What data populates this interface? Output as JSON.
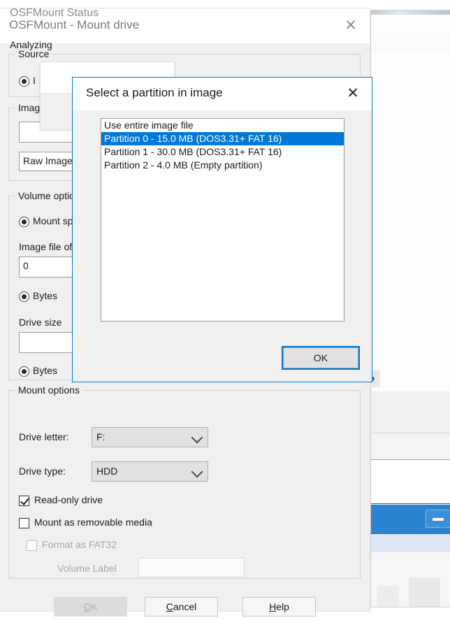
{
  "background_windows": {
    "right_window": {
      "maximize_icon": "maximize-icon",
      "close_icon": "close-icon"
    },
    "scroll_arrow": "›"
  },
  "main_window": {
    "title": "OSFMount - Mount drive",
    "close_icon": "✕",
    "source_group": {
      "legend": "Source",
      "radio_label": "I",
      "radio_checked": true
    },
    "image_group": {
      "legend": "Imag",
      "path_value": "",
      "format_value": "Raw Image"
    },
    "volume_group": {
      "legend": "Volume options",
      "mount_radio_label": "Mount spe",
      "mount_radio_checked": true,
      "offset_label": "Image file offs",
      "offset_value": "0",
      "offset_unit_label": "Bytes",
      "offset_unit_checked": true,
      "drive_size_label": "Drive size",
      "drive_size_value": "",
      "size_unit_label": "Bytes",
      "size_unit_checked": true
    },
    "mount_group": {
      "legend": "Mount options",
      "drive_letter_label": "Drive letter:",
      "drive_letter_value": "F:",
      "drive_type_label": "Drive type:",
      "drive_type_value": "HDD",
      "read_only_label": "Read-only drive",
      "read_only_checked": true,
      "removable_label": "Mount as removable media",
      "removable_checked": false,
      "format_fat32_label": "Format as FAT32",
      "format_fat32_checked": false,
      "format_fat32_enabled": false,
      "volume_label_label": "Volume Label",
      "volume_label_value": "",
      "volume_label_enabled": false
    },
    "buttons": {
      "ok": "OK",
      "ok_enabled": false,
      "cancel": "Cancel",
      "help": "Help"
    }
  },
  "status_dialog": {
    "title": "OSFMount Status",
    "message": "Analyzing"
  },
  "partition_dialog": {
    "title": "Select a partition in image",
    "close_icon": "✕",
    "items": [
      {
        "label": "Use entire image file",
        "selected": false
      },
      {
        "label": "Partition 0 - 15.0 MB (DOS3.31+ FAT 16)",
        "selected": true
      },
      {
        "label": "Partition 1 - 30.0 MB (DOS3.31+ FAT 16)",
        "selected": false
      },
      {
        "label": "Partition 2 - 4.0 MB (Empty partition)",
        "selected": false
      }
    ],
    "ok_button": "OK"
  },
  "colors": {
    "accent": "#0078d7",
    "window_bg": "#f0f0f0",
    "title_text": "#7b7b7b"
  }
}
